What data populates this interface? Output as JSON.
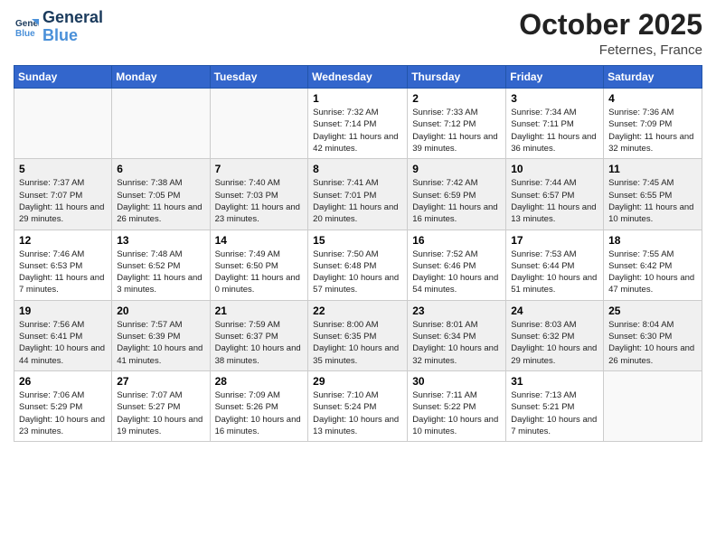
{
  "logo": {
    "line1": "General",
    "line2": "Blue"
  },
  "title": "October 2025",
  "location": "Feternes, France",
  "days_of_week": [
    "Sunday",
    "Monday",
    "Tuesday",
    "Wednesday",
    "Thursday",
    "Friday",
    "Saturday"
  ],
  "weeks": [
    [
      {
        "num": "",
        "info": ""
      },
      {
        "num": "",
        "info": ""
      },
      {
        "num": "",
        "info": ""
      },
      {
        "num": "1",
        "info": "Sunrise: 7:32 AM\nSunset: 7:14 PM\nDaylight: 11 hours\nand 42 minutes."
      },
      {
        "num": "2",
        "info": "Sunrise: 7:33 AM\nSunset: 7:12 PM\nDaylight: 11 hours\nand 39 minutes."
      },
      {
        "num": "3",
        "info": "Sunrise: 7:34 AM\nSunset: 7:11 PM\nDaylight: 11 hours\nand 36 minutes."
      },
      {
        "num": "4",
        "info": "Sunrise: 7:36 AM\nSunset: 7:09 PM\nDaylight: 11 hours\nand 32 minutes."
      }
    ],
    [
      {
        "num": "5",
        "info": "Sunrise: 7:37 AM\nSunset: 7:07 PM\nDaylight: 11 hours\nand 29 minutes."
      },
      {
        "num": "6",
        "info": "Sunrise: 7:38 AM\nSunset: 7:05 PM\nDaylight: 11 hours\nand 26 minutes."
      },
      {
        "num": "7",
        "info": "Sunrise: 7:40 AM\nSunset: 7:03 PM\nDaylight: 11 hours\nand 23 minutes."
      },
      {
        "num": "8",
        "info": "Sunrise: 7:41 AM\nSunset: 7:01 PM\nDaylight: 11 hours\nand 20 minutes."
      },
      {
        "num": "9",
        "info": "Sunrise: 7:42 AM\nSunset: 6:59 PM\nDaylight: 11 hours\nand 16 minutes."
      },
      {
        "num": "10",
        "info": "Sunrise: 7:44 AM\nSunset: 6:57 PM\nDaylight: 11 hours\nand 13 minutes."
      },
      {
        "num": "11",
        "info": "Sunrise: 7:45 AM\nSunset: 6:55 PM\nDaylight: 11 hours\nand 10 minutes."
      }
    ],
    [
      {
        "num": "12",
        "info": "Sunrise: 7:46 AM\nSunset: 6:53 PM\nDaylight: 11 hours\nand 7 minutes."
      },
      {
        "num": "13",
        "info": "Sunrise: 7:48 AM\nSunset: 6:52 PM\nDaylight: 11 hours\nand 3 minutes."
      },
      {
        "num": "14",
        "info": "Sunrise: 7:49 AM\nSunset: 6:50 PM\nDaylight: 11 hours\nand 0 minutes."
      },
      {
        "num": "15",
        "info": "Sunrise: 7:50 AM\nSunset: 6:48 PM\nDaylight: 10 hours\nand 57 minutes."
      },
      {
        "num": "16",
        "info": "Sunrise: 7:52 AM\nSunset: 6:46 PM\nDaylight: 10 hours\nand 54 minutes."
      },
      {
        "num": "17",
        "info": "Sunrise: 7:53 AM\nSunset: 6:44 PM\nDaylight: 10 hours\nand 51 minutes."
      },
      {
        "num": "18",
        "info": "Sunrise: 7:55 AM\nSunset: 6:42 PM\nDaylight: 10 hours\nand 47 minutes."
      }
    ],
    [
      {
        "num": "19",
        "info": "Sunrise: 7:56 AM\nSunset: 6:41 PM\nDaylight: 10 hours\nand 44 minutes."
      },
      {
        "num": "20",
        "info": "Sunrise: 7:57 AM\nSunset: 6:39 PM\nDaylight: 10 hours\nand 41 minutes."
      },
      {
        "num": "21",
        "info": "Sunrise: 7:59 AM\nSunset: 6:37 PM\nDaylight: 10 hours\nand 38 minutes."
      },
      {
        "num": "22",
        "info": "Sunrise: 8:00 AM\nSunset: 6:35 PM\nDaylight: 10 hours\nand 35 minutes."
      },
      {
        "num": "23",
        "info": "Sunrise: 8:01 AM\nSunset: 6:34 PM\nDaylight: 10 hours\nand 32 minutes."
      },
      {
        "num": "24",
        "info": "Sunrise: 8:03 AM\nSunset: 6:32 PM\nDaylight: 10 hours\nand 29 minutes."
      },
      {
        "num": "25",
        "info": "Sunrise: 8:04 AM\nSunset: 6:30 PM\nDaylight: 10 hours\nand 26 minutes."
      }
    ],
    [
      {
        "num": "26",
        "info": "Sunrise: 7:06 AM\nSunset: 5:29 PM\nDaylight: 10 hours\nand 23 minutes."
      },
      {
        "num": "27",
        "info": "Sunrise: 7:07 AM\nSunset: 5:27 PM\nDaylight: 10 hours\nand 19 minutes."
      },
      {
        "num": "28",
        "info": "Sunrise: 7:09 AM\nSunset: 5:26 PM\nDaylight: 10 hours\nand 16 minutes."
      },
      {
        "num": "29",
        "info": "Sunrise: 7:10 AM\nSunset: 5:24 PM\nDaylight: 10 hours\nand 13 minutes."
      },
      {
        "num": "30",
        "info": "Sunrise: 7:11 AM\nSunset: 5:22 PM\nDaylight: 10 hours\nand 10 minutes."
      },
      {
        "num": "31",
        "info": "Sunrise: 7:13 AM\nSunset: 5:21 PM\nDaylight: 10 hours\nand 7 minutes."
      },
      {
        "num": "",
        "info": ""
      }
    ]
  ]
}
